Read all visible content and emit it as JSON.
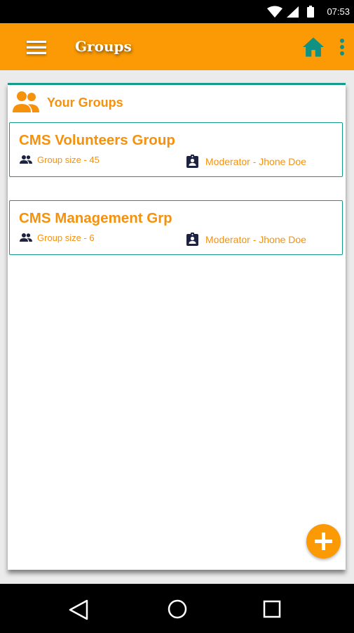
{
  "status_bar": {
    "time": "07:53"
  },
  "app_bar": {
    "title": "Groups",
    "menu_icon": "hamburger-menu-icon",
    "home_icon": "home-icon",
    "more_icon": "more-vert-icon",
    "accent_color": "#fb9a04",
    "icon_color": "#0f9284"
  },
  "groups_card": {
    "title": "Your Groups",
    "icon": "people-icon",
    "groups": [
      {
        "name": "CMS Volunteers Group",
        "size_label": "Group size - 45",
        "moderator_label": "Moderator - Jhone Doe"
      },
      {
        "name": "CMS Management Grp",
        "size_label": "Group size - 6",
        "moderator_label": "Moderator - Jhone Doe"
      }
    ]
  },
  "fab": {
    "icon": "add-icon"
  },
  "nav_bar": {
    "icons": [
      "back-icon",
      "home-circle-icon",
      "recent-apps-icon"
    ]
  }
}
